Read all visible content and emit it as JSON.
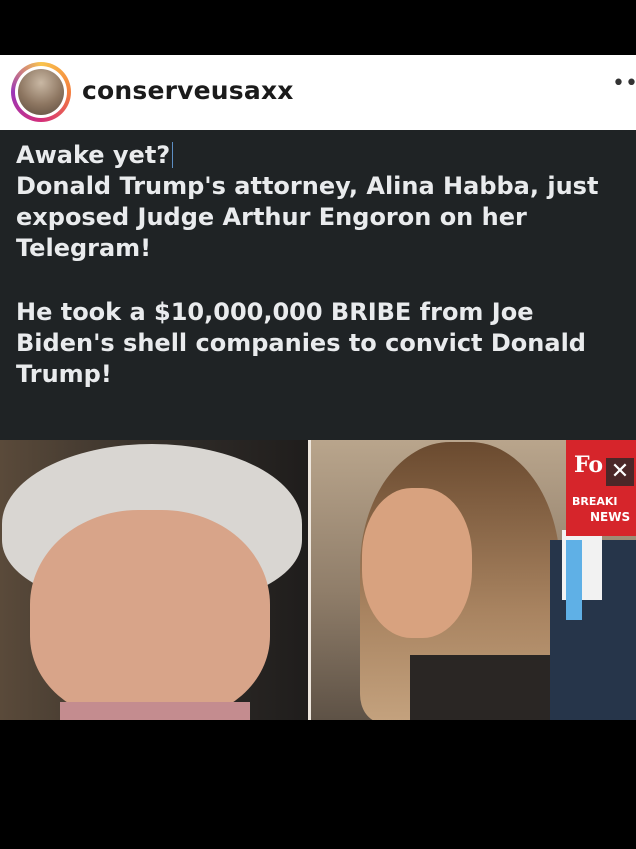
{
  "header": {
    "username": "conserveusaxx",
    "more_label": "•••"
  },
  "post": {
    "line1": "Awake yet?",
    "line2": "Donald Trump's attorney, Alina Habba, just exposed Judge Arthur Engoron on her Telegram!",
    "line3": "He took a $10,000,000 BRIBE from Joe Biden's shell companies to convict Donald Trump!"
  },
  "news_badge": {
    "brand_partial": "Fo",
    "close_glyph": "✕",
    "line1_partial": "BREAKI",
    "line2_partial": "NEWS"
  },
  "colors": {
    "text_bg": "#1f2325",
    "text_fg": "#e9ebed",
    "badge_red": "#d6252b"
  }
}
